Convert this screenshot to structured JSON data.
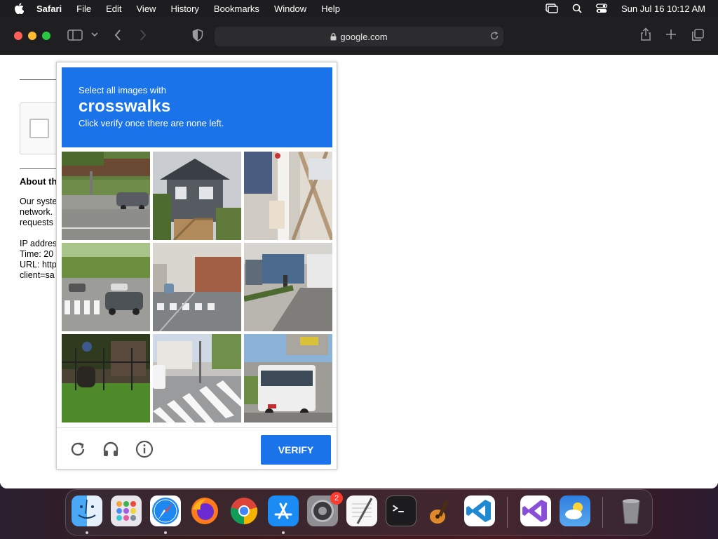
{
  "menubar": {
    "app_name": "Safari",
    "items": [
      "File",
      "Edit",
      "View",
      "History",
      "Bookmarks",
      "Window",
      "Help"
    ],
    "clock": "Sun Jul 16  10:12 AM"
  },
  "browser": {
    "address": "google.com"
  },
  "page": {
    "about_heading": "About th",
    "paragraph_lines": [
      "Our syste",
      "network.",
      "requests"
    ],
    "info_lines": [
      "IP addres",
      "Time: 20",
      "URL: http",
      "client=sa"
    ]
  },
  "captcha": {
    "instruction_line1": "Select all images with",
    "target": "crosswalks",
    "instruction_line3": "Click verify once there are none left.",
    "verify_label": "VERIFY",
    "tiles": [
      {
        "id": "tile-1",
        "scene": "road-with-car"
      },
      {
        "id": "tile-2",
        "scene": "houses"
      },
      {
        "id": "tile-3",
        "scene": "fire-hydrant-fence"
      },
      {
        "id": "tile-4",
        "scene": "crosswalk-trees-car"
      },
      {
        "id": "tile-5",
        "scene": "crosswalk-street"
      },
      {
        "id": "tile-6",
        "scene": "bus-street"
      },
      {
        "id": "tile-7",
        "scene": "grass-fence"
      },
      {
        "id": "tile-8",
        "scene": "crosswalk-intersection"
      },
      {
        "id": "tile-9",
        "scene": "bus"
      }
    ]
  },
  "dock": {
    "apps": [
      "Finder",
      "Launchpad",
      "Safari",
      "Firefox",
      "Chrome",
      "App Store",
      "System Settings",
      "TextEdit",
      "Terminal",
      "GarageBand",
      "Visual Studio Code",
      "Visual Studio",
      "Weather",
      "Trash"
    ],
    "settings_badge": "2"
  },
  "colors": {
    "captcha_blue": "#1a73e8",
    "toolbar": "#1f1f21"
  }
}
